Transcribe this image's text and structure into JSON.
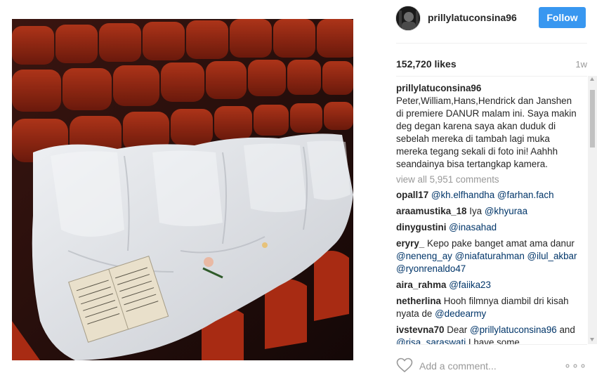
{
  "post": {
    "username": "prillylatuconsina96",
    "follow_label": "Follow",
    "likes": "152,720 likes",
    "time_ago": "1w",
    "caption_user": "prillylatuconsina96",
    "caption_text": "Peter,William,Hans,Hendrick dan Janshen di premiere DANUR malam ini. Saya makin deg degan karena saya akan duduk di sebelah mereka di tambah lagi muka mereka tegang sekali di foto ini! Aahhh seandainya bisa tertangkap kamera.",
    "view_all": "view all 5,951 comments",
    "add_comment_placeholder": "Add a comment...",
    "more_label": "∘∘∘"
  },
  "comments": [
    {
      "user": "opall17",
      "text": "",
      "mentions": [
        "@kh.elfhandha",
        "@farhan.fach"
      ]
    },
    {
      "user": "araamustika_18",
      "text": "Iya ",
      "mentions": [
        "@khyuraa"
      ]
    },
    {
      "user": "dinygustini",
      "text": "",
      "mentions": [
        "@inasahad"
      ]
    },
    {
      "user": "eryry_",
      "text": "Kepo pake banget amat ama danur ",
      "mentions": [
        "@neneng_ay",
        "@niafaturahman",
        "@ilul_akbar",
        "@ryonrenaldo47"
      ]
    },
    {
      "user": "aira_rahma",
      "text": "",
      "mentions": [
        "@faiika23"
      ]
    },
    {
      "user": "netherlina",
      "text": "Hooh filmnya diambil dri kisah nyata de ",
      "mentions": [
        "@dedearmy"
      ]
    },
    {
      "user": "ivstevna70",
      "text": "Dear ",
      "mentions": [
        "@prillylatuconsina96"
      ],
      "tail": " and ",
      "mentions2": [
        "@risa_saraswati"
      ],
      "tail2": " I have some"
    }
  ],
  "colors": {
    "accent": "#3897f0",
    "mention": "#003569",
    "muted": "#999999",
    "seat_red": "#9e2a14",
    "sheet_white": "#e7e9ec"
  },
  "icons": {
    "like": "heart-outline-icon",
    "more": "more-options-icon"
  }
}
